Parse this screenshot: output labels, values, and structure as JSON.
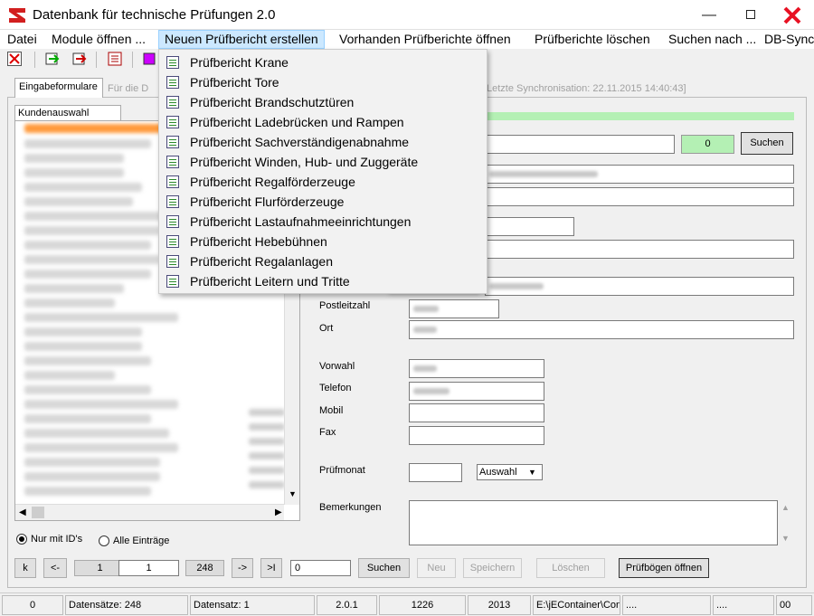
{
  "window": {
    "title": "Datenbank für technische Prüfungen 2.0"
  },
  "menu": [
    "Datei",
    "Module öffnen ...",
    "Neuen Prüfbericht erstellen",
    "Vorhanden Prüfberichte öffnen",
    "Prüfberichte löschen",
    "Suchen nach ...",
    "DB-Sync"
  ],
  "dropdown": [
    "Prüfbericht Krane",
    "Prüfbericht Tore",
    "Prüfbericht Brandschutztüren",
    "Prüfbericht Ladebrücken und Rampen",
    "Prüfbericht Sachverständigenabnahme",
    "Prüfbericht Winden, Hub- und Zuggeräte",
    "Prüfbericht Regalförderzeuge",
    "Prüfbericht Flurförderzeuge",
    "Prüfbericht Lastaufnahmeeinrichtungen",
    "Prüfbericht Hebebühnen",
    "Prüfbericht Regalanlagen",
    "Prüfbericht Leitern und Tritte"
  ],
  "tabs": {
    "active": "Eingabeformulare",
    "inactive": "Für die D"
  },
  "sync_text": "Letzte Synchronisation: 22.11.2015 14:40:43]",
  "subtab": "Kundenauswahl",
  "search": {
    "count": "0",
    "button": "Suchen"
  },
  "form": {
    "postleitzahl": "Postleitzahl",
    "ort": "Ort",
    "vorwahl": "Vorwahl",
    "telefon": "Telefon",
    "mobil": "Mobil",
    "fax": "Fax",
    "pruefmonat": "Prüfmonat",
    "auswahl": "Auswahl",
    "bemerkungen": "Bemerkungen"
  },
  "radios": {
    "option1": "Nur mit ID's",
    "option2": "Alle Einträge"
  },
  "nav": {
    "first": "k",
    "prev": "<-",
    "current_gray": "1",
    "current": "1",
    "total": "248",
    "next": "->",
    "last": ">I",
    "search_value": "0",
    "search": "Suchen",
    "new": "Neu",
    "save": "Speichern",
    "delete": "Löschen",
    "open_sheets": "Prüfbögen öffnen"
  },
  "status": [
    "0",
    "Datensätze: 248",
    "Datensatz: 1",
    "2.0.1",
    "1226",
    "2013",
    "E:\\jEContainer\\Con",
    "....",
    "....",
    "00"
  ],
  "colors": {
    "accent_green": "#b4f0b4",
    "menu_highlight": "#cce8ff",
    "close_red": "#e81123"
  }
}
